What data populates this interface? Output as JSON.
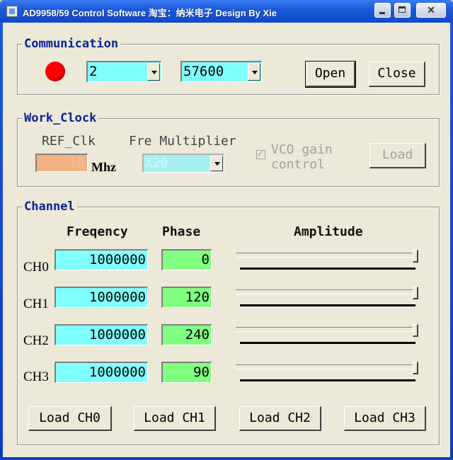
{
  "window": {
    "title": "AD9958/59 Control Software 淘宝：纳米电子 Design By Xie",
    "close_glyph": "✕"
  },
  "communication": {
    "legend": "Communication",
    "status_color": "#ff0000",
    "port": "2",
    "baud": "57600",
    "open_label": "Open",
    "close_label": "Close"
  },
  "work_clock": {
    "legend": "Work_Clock",
    "ref_label": "REF_Clk",
    "ref_value": "10",
    "unit": "Mhz",
    "mult_label": "Fre Multiplier",
    "mult_value": "X20",
    "vco_label_1": "VCO gain",
    "vco_label_2": "control",
    "vco_check_glyph": "✓",
    "load_label": "Load"
  },
  "channel": {
    "legend": "Channel",
    "col_freq": "Freqency",
    "col_phase": "Phase",
    "col_amp": "Amplitude",
    "rows": [
      {
        "name": "CH0",
        "freq": "1000000",
        "phase": "0",
        "amplitude": 1.0
      },
      {
        "name": "CH1",
        "freq": "1000000",
        "phase": "120",
        "amplitude": 1.0
      },
      {
        "name": "CH2",
        "freq": "1000000",
        "phase": "240",
        "amplitude": 1.0
      },
      {
        "name": "CH3",
        "freq": "1000000",
        "phase": "90",
        "amplitude": 1.0
      }
    ],
    "load_buttons": [
      "Load CH0",
      "Load CH1",
      "Load CH2",
      "Load CH3"
    ]
  }
}
